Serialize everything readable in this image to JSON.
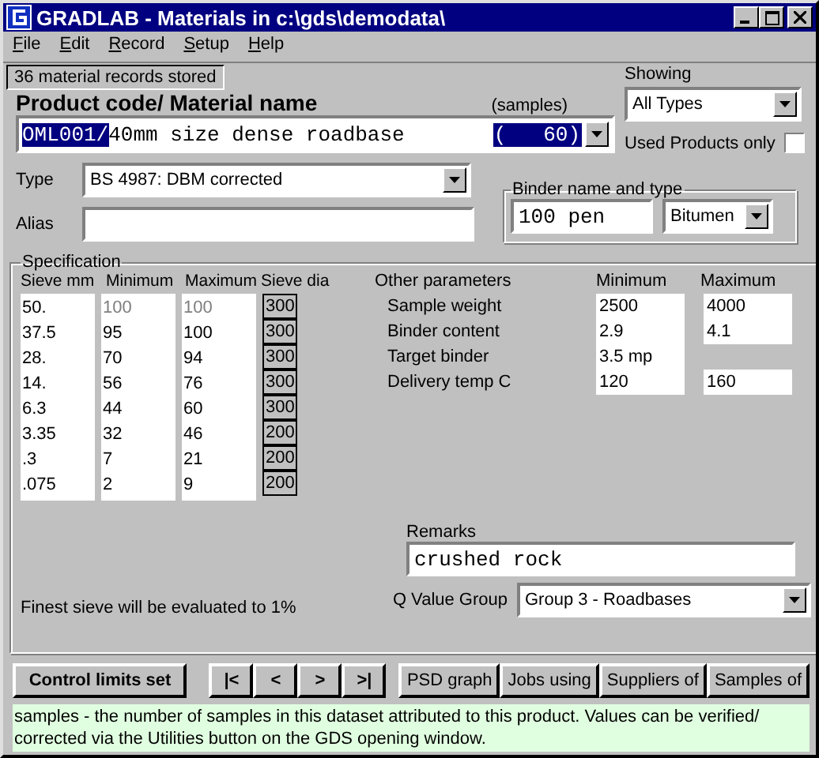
{
  "window": {
    "title": "GRADLAB - Materials in c:\\gds\\demodata\\"
  },
  "menu": [
    "File",
    "Edit",
    "Record",
    "Setup",
    "Help"
  ],
  "record_count": "36 material records stored",
  "product": {
    "label": "Product code/ Material name",
    "samples_label": "(samples)",
    "code": "OML001/",
    "name": "40mm size dense roadbase",
    "samples": "(   60)"
  },
  "showing": {
    "label": "Showing",
    "value": "All Types"
  },
  "used_products_only": {
    "label": "Used Products only",
    "checked": false
  },
  "type": {
    "label": "Type",
    "value": "BS 4987: DBM corrected"
  },
  "alias": {
    "label": "Alias"
  },
  "binder": {
    "label": "Binder name and type",
    "name": "100 pen",
    "type": "Bitumen"
  },
  "specification": {
    "title": "Specification",
    "columns": [
      "Sieve mm",
      "Minimum",
      "Maximum",
      "Sieve dia"
    ],
    "rows": [
      {
        "sieve": "50.",
        "min": "100",
        "max": "100",
        "dia": "300",
        "disabled": true
      },
      {
        "sieve": "37.5",
        "min": "95",
        "max": "100",
        "dia": "300",
        "disabled": false
      },
      {
        "sieve": "28.",
        "min": "70",
        "max": "94",
        "dia": "300",
        "disabled": false
      },
      {
        "sieve": "14.",
        "min": "56",
        "max": "76",
        "dia": "300",
        "disabled": false
      },
      {
        "sieve": "6.3",
        "min": "44",
        "max": "60",
        "dia": "300",
        "disabled": false
      },
      {
        "sieve": "3.35",
        "min": "32",
        "max": "46",
        "dia": "200",
        "disabled": false
      },
      {
        "sieve": ".3",
        "min": "7",
        "max": "21",
        "dia": "200",
        "disabled": false
      },
      {
        "sieve": ".075",
        "min": "2",
        "max": "9",
        "dia": "200",
        "disabled": false
      }
    ],
    "other_columns": [
      "Other parameters",
      "Minimum",
      "Maximum"
    ],
    "other_rows": [
      {
        "label": "Sample weight",
        "min": "2500",
        "max": "4000"
      },
      {
        "label": "Binder content",
        "min": "2.9",
        "max": "4.1"
      },
      {
        "label": "Target binder",
        "min": "3.5 mp"
      },
      {
        "label": "Delivery temp C",
        "min": "120",
        "max": "160"
      }
    ],
    "remarks_label": "Remarks",
    "remarks": "crushed rock",
    "finest_note": "Finest sieve will be evaluated to 1%",
    "q_label": "Q Value Group",
    "q_value": "Group 3 - Roadbases"
  },
  "buttons": {
    "control": "Control limits set",
    "nav": [
      "|<",
      "<",
      ">",
      ">|"
    ],
    "actions": [
      "PSD graph",
      "Jobs using",
      "Suppliers of",
      "Samples of"
    ]
  },
  "help_text": "samples - the number of samples in this dataset attributed to this product. Values can be verified/ corrected via the Utilities button on the GDS opening window."
}
